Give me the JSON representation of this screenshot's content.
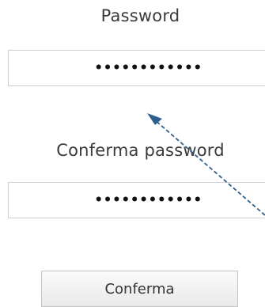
{
  "form": {
    "password_label": "Password",
    "password_value": "••••••••••••",
    "confirm_label": "Conferma password",
    "confirm_value": "••••••••••••",
    "submit_label": "Conferma"
  },
  "colors": {
    "arrow": "#2f5f8f",
    "field_border": "#cfcfcf",
    "text": "#3a3a3a"
  },
  "icons": {
    "annotation": "dashed-arrow-icon"
  }
}
